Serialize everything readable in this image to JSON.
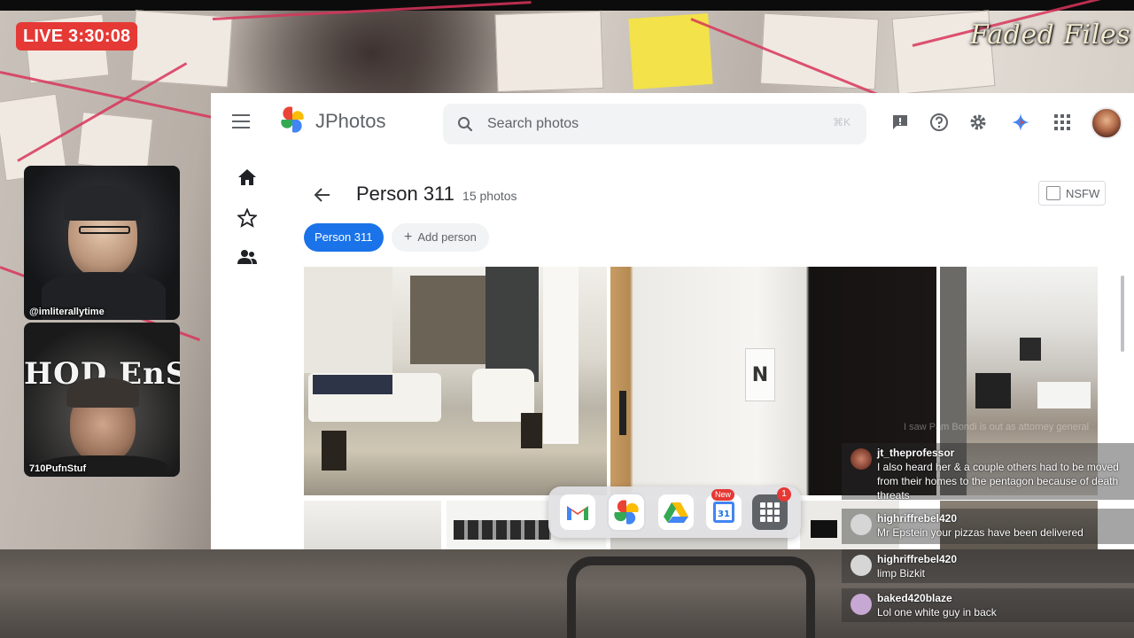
{
  "stream": {
    "live_label": "LIVE 3:30:08",
    "channel_logo_text": "Faded Files",
    "cams": [
      {
        "name": "@imliterallytime"
      },
      {
        "name": "710PufnStuf",
        "banner_text": "HOD EnSt"
      }
    ]
  },
  "app": {
    "title": "JPhotos",
    "search": {
      "placeholder": "Search photos",
      "shortcut": "⌘K"
    },
    "album": {
      "title": "Person 311",
      "count": "15 photos"
    },
    "nsfw_label": "NSFW",
    "chips": {
      "active": "Person 311",
      "add_label": "Add person",
      "add_symbol": "+"
    },
    "dock": {
      "new_badge": "New",
      "notification_count": "1"
    }
  },
  "chat": {
    "faded_line": "I saw Pam Bondi is out as attorney general",
    "messages": [
      {
        "user": "jt_theprofessor",
        "text": "I also heard her & a couple others had to be moved from their homes to the pentagon because of death threats"
      },
      {
        "user": "highriffrebel420",
        "text": "Mr Epstein your pizzas have been delivered"
      },
      {
        "user": "highriffrebel420",
        "text": "limp Bizkit"
      },
      {
        "user": "baked420blaze",
        "text": "Lol one white guy in back"
      }
    ]
  },
  "colors": {
    "accent": "#1a73e8",
    "live": "#e53935",
    "text_primary": "#202124",
    "text_secondary": "#5f6368"
  }
}
